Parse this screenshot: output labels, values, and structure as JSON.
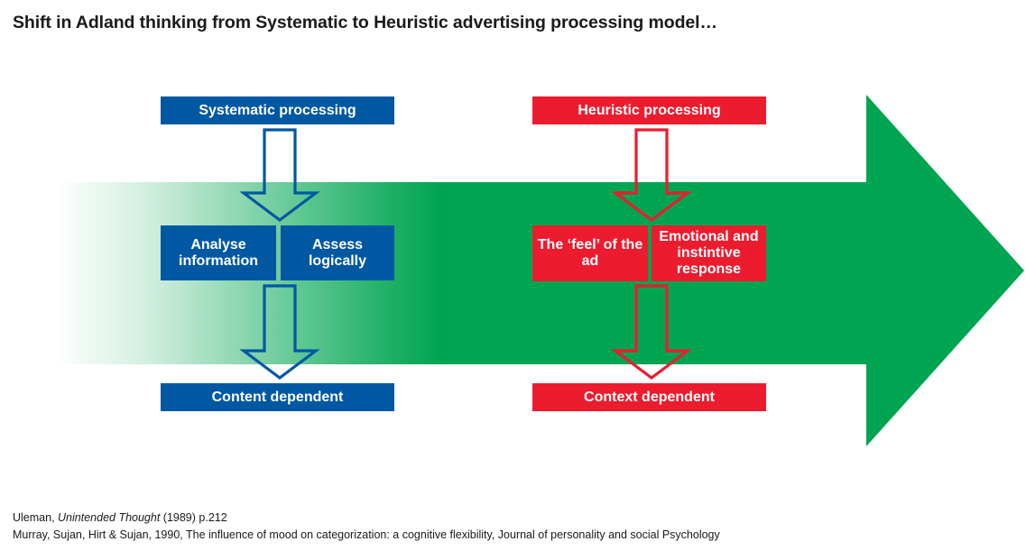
{
  "page": {
    "title": "Shift in Adland thinking from Systematic to Heuristic advertising processing model…"
  },
  "colors": {
    "blue": "#0058A3",
    "red": "#ED1B2E",
    "green": "#00A551",
    "background": "#FFFFFF",
    "text": "#1A1A1A"
  },
  "diagram": {
    "background_arrow_label": "green-right-arrow",
    "columns": [
      {
        "id": "systematic",
        "accent": "#0058A3",
        "header": "Systematic processing",
        "middle": [
          "Analyse information",
          "Assess logically"
        ],
        "footer": "Content dependent"
      },
      {
        "id": "heuristic",
        "accent": "#ED1B2E",
        "header": "Heuristic processing",
        "middle": [
          "The ‘feel’ of the ad",
          "Emotional and instintive response"
        ],
        "footer": "Context dependent"
      }
    ],
    "connectors": [
      {
        "id": "systematic-top",
        "direction": "down",
        "color": "#0058A3"
      },
      {
        "id": "systematic-bottom",
        "direction": "down",
        "color": "#0058A3"
      },
      {
        "id": "heuristic-top",
        "direction": "down",
        "color": "#ED1B2E"
      },
      {
        "id": "heuristic-bottom",
        "direction": "down",
        "color": "#ED1B2E"
      }
    ]
  },
  "footer": {
    "line1_pre": "Uleman, ",
    "line1_italic": "Unintended Thought",
    "line1_post": " (1989) p.212",
    "line2": "Murray, Sujan, Hirt & Sujan, 1990, The influence of mood on categorization: a cognitive flexibility, Journal of personality and social Psychology"
  }
}
